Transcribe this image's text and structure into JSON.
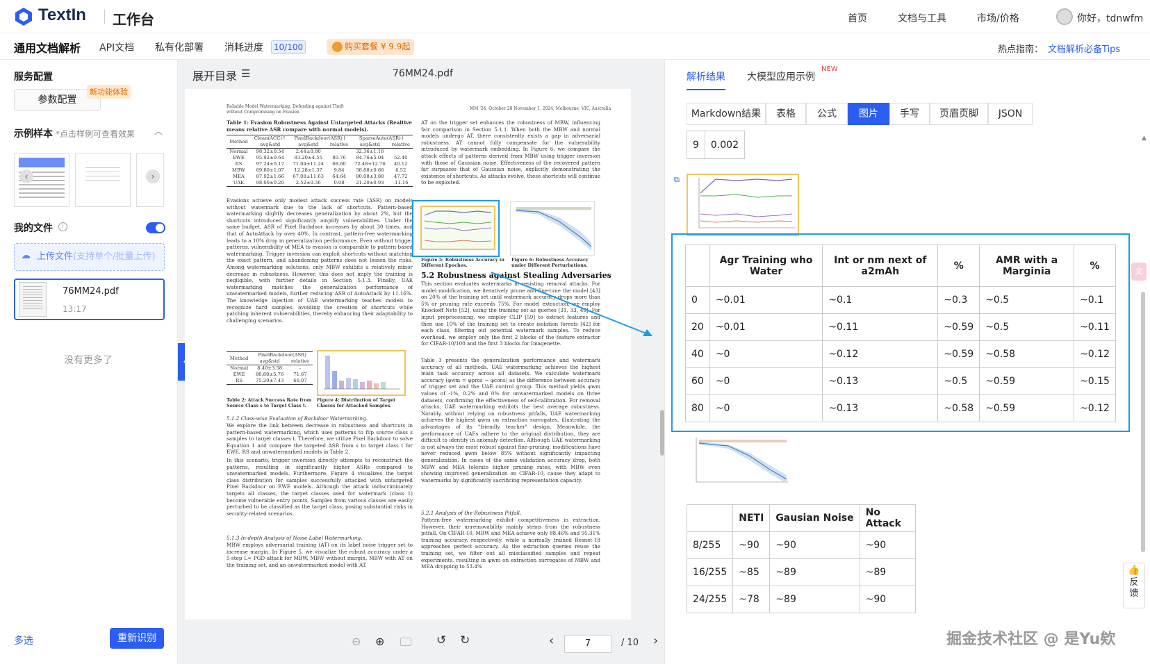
{
  "topnav": {
    "brand": "TextIn",
    "workbench": "工作台",
    "links": [
      "首页",
      "文档与工具",
      "市场/价格"
    ],
    "greeting": "你好，tdnwfm"
  },
  "subnav": {
    "tabs": [
      "通用文档解析",
      "API文档",
      "私有化部署",
      "消耗进度"
    ],
    "progress": "10/100",
    "buy": "购买套餐 ¥ 9.9起",
    "hot_label": "热点指南：",
    "hot_link": "文档解析必备Tips"
  },
  "left": {
    "service_config": "服务配置",
    "param_button": "参数配置",
    "new_badge": "新功能体验",
    "samples_title": "示例样本",
    "samples_hint": "*点击样例可查看效果",
    "my_files": "我的文件",
    "upload": "上传文件",
    "upload_hint": "(支持单个/批量上传)",
    "file_name": "76MM24.pdf",
    "file_time": "13:17",
    "no_more": "没有更多了",
    "multi_select": "多选",
    "recognize": "重新识别"
  },
  "middle": {
    "toc": "展开目录",
    "file_title": "76MM24.pdf",
    "current_page": "7",
    "total_pages": "/ 10"
  },
  "doc": {
    "running_left": "Reliable Model Watermarking: Defending against Theft without Compromising on Evasion",
    "running_right": "MM '24, October 28 November 1, 2024, Melbourne, VIC, Australia",
    "table1_caption": "Table 1: Evasion Robustness Against Untargeted Attacks (Realtive means relative ASR compare with normal models).",
    "table1_header1": [
      "Method",
      "Clean(ACC)↑",
      "PixelBackdoor(ASR)↓",
      "SparseAuto(ASR)↓"
    ],
    "table1_header2": [
      "avg&std",
      "avg&std",
      "relative",
      "avg&std",
      "relative"
    ],
    "table1_rows": [
      [
        "Normal",
        "98.32±0.54",
        "2.44±0.80",
        "",
        "32.36±1.16",
        ""
      ],
      [
        "EWE",
        "95.92±0.64",
        "83.20±4.55",
        "80.76",
        "84.76±5.04",
        "52.40"
      ],
      [
        "RS",
        "97.24±0.17",
        "71.04±11.24",
        "68.60",
        "72.48±12.76",
        "40.12"
      ],
      [
        "MBW",
        "89.80±1.07",
        "12.28±1.37",
        "9.84",
        "38.88±0.66",
        "6.52"
      ],
      [
        "MEA",
        "87.92±1.66",
        "67.08±11.63",
        "64.64",
        "80.08±3.88",
        "47.72"
      ],
      [
        "UAE",
        "98.00±0.20",
        "2.52±0.36",
        "0.08",
        "21.20±0.93",
        "-11.16"
      ]
    ],
    "para1": "Evasions achieve only modest attack success rate (ASR) on models without watermark due to the lack of shortcuts. Pattern-based watermarking slightly decreases generalization by about 2%, but the shortcuts introduced significantly amplify vulnerabilities. Under the same budget, ASR of Pixel Backdoor increases by about 30 times, and that of AutoAttack by over 40%. In contrast, pattern-free watermarking leads to a 10% drop in generalization performance. Even without trigger patterns, vulnerability of MEA to evasion is comparable to pattern-based watermarking. Trigger inversion can exploit shortcuts without matching the exact pattern, and abandoning patterns does not lessen the risks. Among watermarking solutions, only MBW exhibits a relatively minor decrease in robustness. However, this does not imply the training is negligible, with further details in Section 5.1.3. Finally, UAE watermarking matches the generalization performance of unwatermarked models, further reducing ASR of AutoAttack by 11.16%. The knowledge injection of UAE watermarking teaches models to recognize hard samples, avoiding the creation of shortcuts while patching inherent vulnerabilities, thereby enhancing their adaptability to challenging scenarios.",
    "table2_header1": [
      "Method",
      "PixelBackdoor(ASR)"
    ],
    "table2_header2": [
      "avg&std",
      "relative"
    ],
    "table2_rows": [
      [
        "Normal",
        "8.40±3.58",
        "-"
      ],
      [
        "EWE",
        "80.80±5.76",
        "71.67"
      ],
      [
        "RS",
        "75.20±7.43",
        "66.07"
      ]
    ],
    "table2_caption": "Table 2: Attack Success Rate from Source Class s to Target Class t.",
    "fig4_caption": "Figure 4: Distribution of Target Classes for Attacked Samples.",
    "sec512": "5.1.2   Class-wise Evaluation of Backdoor Watermarking.",
    "para2": "We explore the link between decrease in robustness and shortcuts in pattern-based watermarking, which uses patterns to flip source class s samples to target classes t. Therefore, we utilize Pixel Backdoor to solve Equation 1 and compare the targeted ASR from s to target class t for EWE, RS and unwatermarked models in Table 2.",
    "para3": "In this scenario, trigger inversion directly attempts to reconstruct the patterns, resulting in significantly higher ASRs compared to unwatermarked models. Furthermore, Figure 4 visualizes the target class distribution for samples successfully attacked with untargeted Pixel Backdoor on EWE models. Although the attack indiscriminately targets all classes, the target classes used for watermark (class 1) become vulnerable entry points. Samples from various classes are easily perturbed to be classified as the target class, posing substantial risks in security-related scenarios.",
    "sec513": "5.1.3   In-depth Analysis of Noise Label Watermarking.",
    "para4": "MBW employs adversarial training (AT) on its label noise trigger set to increase margin. In Figure 5, we visualize the robust accuracy under a 5-step L∞ PGD attack for MBW, MBW without margin, MBW with AT on the training set, and an unwatermarked model with AT.",
    "para_r1": "AT on the trigger set enhances the robustness of MBW, influencing fair comparison in Section 5.1.1. When both the MBW and normal models undergo AT, there consistently exists a gap in adversarial robustness. AT cannot fully compensate for the vulnerability introduced by watermark embedding. In Figure 6, we compare the attack effects of patterns derived from MBW using trigger inversion with those of Gaussian noise. Effectiveness of the recovered pattern far surpasses that of Gaussian noise, explicitly demonstrating the existence of shortcuts. As attacks evolve, these shortcuts will continue to be exploited.",
    "fig5_caption": "Figure 5: Robustness Accuracy in Different Epoches.",
    "fig6_caption": "Figure 6: Robustness Accuracy under Different Perturbations.",
    "sec52": "5.2   Robustness against Stealing Adversaries",
    "para_r2": "This section evaluates watermarks in resisting removal attacks. For model modification, we iteratively prune and fine-tune the model [43] on 20% of the training set until watermark accuracy drops more than 5% or pruning rate exceeds 75%. For model extraction, we employ Knockoff Nets [52], using the training set as queries [31, 33, 46]. For input preprocessing, we employ CLIP [59] to extract features and then use 10% of the training set to create isolation forests [42] for each class, filtering out potential watermark samples. To reduce overhead, we employ only the first 2 blocks of the feature extractor for CIFAR-10/100 and the first 3 blocks for Imagenette.",
    "para_r3": "Table 3 presents the generalization performance and watermark accuracy of all methods. UAE watermarking achieves the highest main task accuracy across all datasets. We calculate watermark accuracy (φwm = φpros − φcons) as the difference between accuracy of trigger set and the UAE control group. This method yields φwm values of -1%, 0.2% and 0% for unwatermarked models on three datasets, confirming the effectiveness of self-calibration. For removal attacks, UAE watermarking exhibits the best average robustness. Notably, without relying on robustness pitfalls, UAE watermarking achieves the highest φwm on extraction surrogates, illustrating the advantages of its \"friendly teacher\" design. Meanwhile, the performance of UAEs adhere to the original distribution, they are difficult to identify in anomaly detection. Although UAE watermarking is not always the most robust against fine-pruning, modifications have never reduced φwm below 85% without significantly impacting generalization. In cases of the same validation accuracy drop, both MBW and MEA tolerate higher pruning rates, with MBW even showing improved generalization on CIFAR-10, cause they adapt to watermarks by significantly sacrificing representation capacity.",
    "sec521": "5.2.1   Analysis of the Robustness Pitfall.",
    "para_r4": "Pattern-free watermarking exhibit competitiveness in extraction. However, their unremovability mainly stems from the robustness pitfall. On CIFAR-10, MBW and MEA achieve only 88.46% and 95.31% training accuracy, respectively, while a normally trained Resnet-18 approaches perfect accuracy. As the extraction queries reuse the training set, we filter out all misclassified samples and repeat experiments, resulting in φwm on extraction surrogates of MBW and MEA dropping to 53.4%"
  },
  "right": {
    "tabs": [
      "解析结果",
      "大模型应用示例"
    ],
    "new_sup": "NEW",
    "subtabs": [
      "Markdown结果",
      "表格",
      "公式",
      "图片",
      "手写",
      "页眉页脚",
      "JSON"
    ],
    "active_subtab": "图片",
    "top_row": [
      "9",
      "0.002"
    ],
    "table_a_header": [
      "",
      "Agr Training who Water",
      "Int or nm next of a2mAh",
      "%",
      "AMR with a Marginia",
      "%"
    ],
    "table_a_rows": [
      [
        "0",
        "~0.01",
        "~0.1",
        "~0.3",
        "~0.5",
        "~0.1"
      ],
      [
        "20",
        "~0.01",
        "~0.11",
        "~0.59",
        "~0.5",
        "~0.11"
      ],
      [
        "40",
        "~0",
        "~0.12",
        "~0.59",
        "~0.58",
        "~0.12"
      ],
      [
        "60",
        "~0",
        "~0.13",
        "~0.5",
        "~0.59",
        "~0.15"
      ],
      [
        "80",
        "~0",
        "~0.13",
        "~0.58",
        "~0.59",
        "~0.12"
      ]
    ],
    "table_b_header": [
      "",
      "NETI",
      "Gausian Noise",
      "No Attack"
    ],
    "table_b_rows": [
      [
        "8/255",
        "~90",
        "~90",
        "~90"
      ],
      [
        "16/255",
        "~85",
        "~89",
        "~89"
      ],
      [
        "24/255",
        "~78",
        "~89",
        "~90"
      ]
    ],
    "feedback": "反馈",
    "watermark": "掘金技术社区 @ 是Yu欸"
  },
  "colors": {
    "accent": "#2b5ef0",
    "highlight": "#1e9be6",
    "orange": "#f29a2e"
  }
}
